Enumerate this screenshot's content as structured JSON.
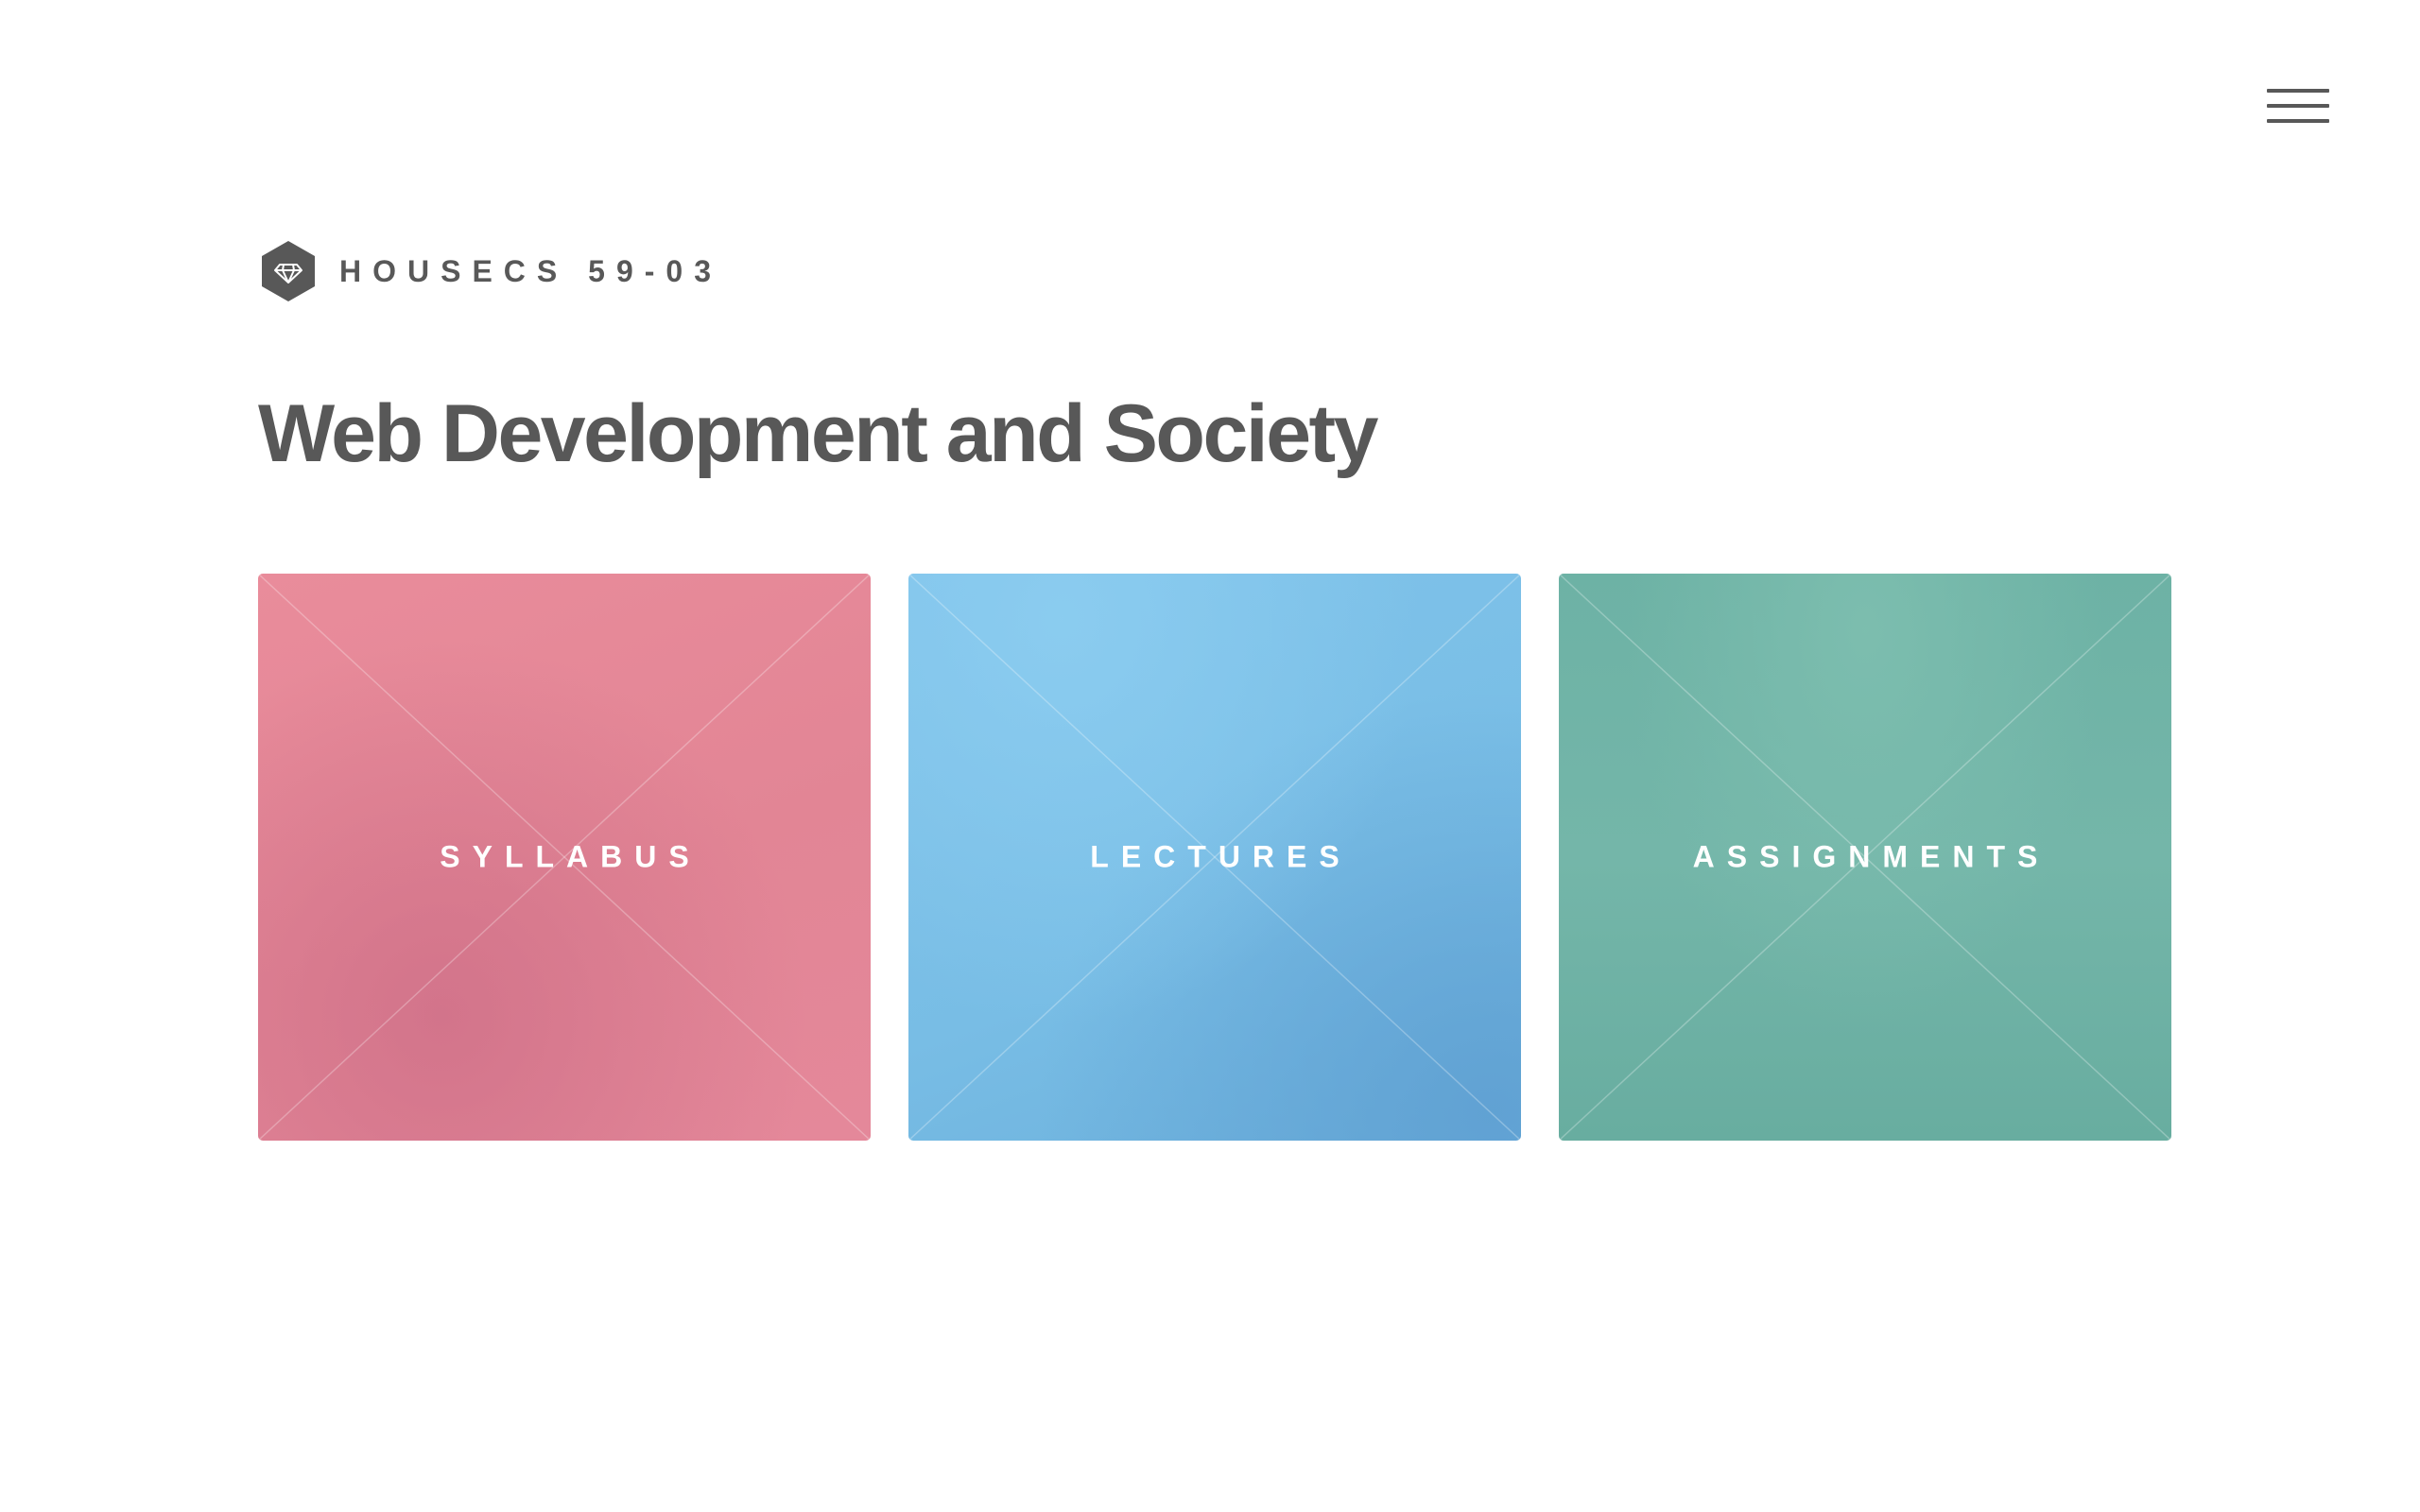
{
  "header": {
    "menu_icon": "hamburger-menu-icon",
    "logo_icon": "diamond-hexagon-icon",
    "logo_text": "HOUSECS 59-03"
  },
  "main": {
    "title": "Web Development and Society",
    "tiles": [
      {
        "label": "SYLLABUS",
        "color": "#e5899a"
      },
      {
        "label": "LECTURES",
        "color": "#79bde6"
      },
      {
        "label": "ASSIGNMENTS",
        "color": "#6fb2a5"
      }
    ]
  },
  "colors": {
    "text": "#585858",
    "background": "#ffffff",
    "tile_text": "#ffffff"
  }
}
